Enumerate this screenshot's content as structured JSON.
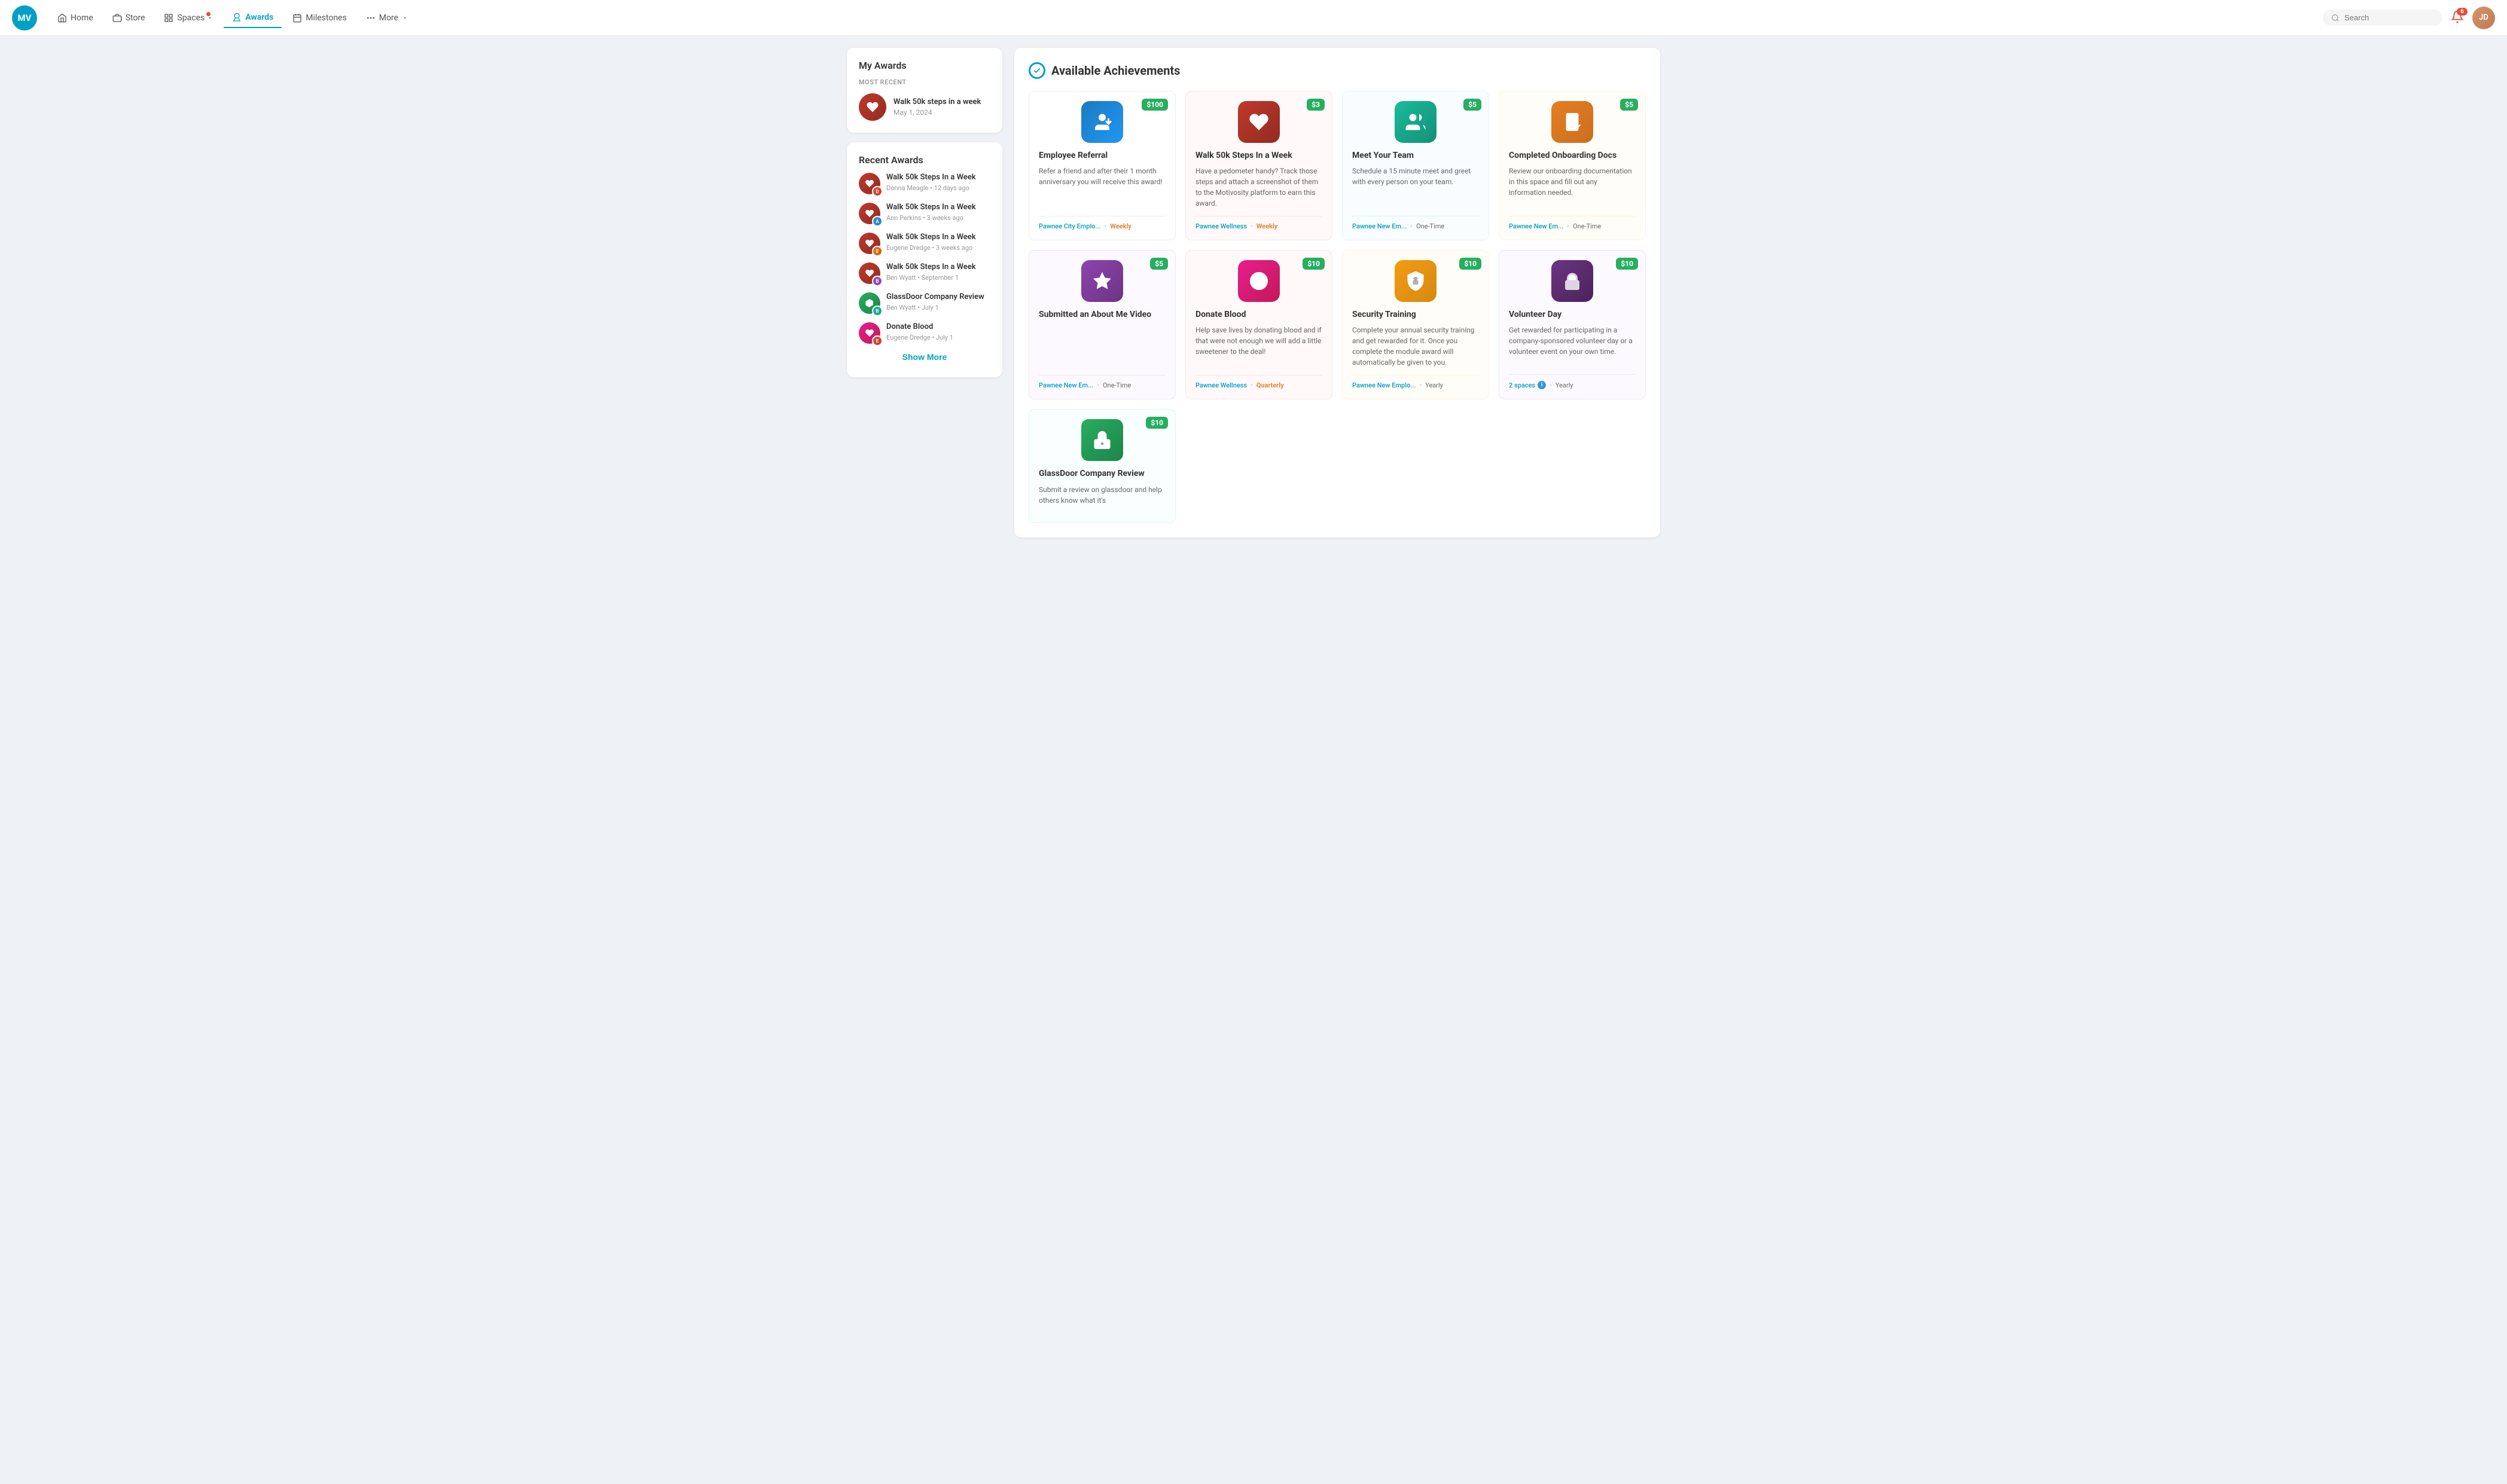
{
  "logo": {
    "initials": "MV"
  },
  "nav": {
    "links": [
      {
        "label": "Home",
        "icon": "home-icon",
        "active": false
      },
      {
        "label": "Store",
        "icon": "store-icon",
        "active": false
      },
      {
        "label": "Spaces",
        "icon": "spaces-icon",
        "active": false,
        "hasDropdown": true,
        "hasDot": true
      },
      {
        "label": "Awards",
        "icon": "awards-icon",
        "active": true
      },
      {
        "label": "Milestones",
        "icon": "milestones-icon",
        "active": false
      },
      {
        "label": "More",
        "icon": "more-icon",
        "active": false,
        "hasDropdown": true
      }
    ],
    "search_placeholder": "Search",
    "notifications_count": "6",
    "avatar_initials": "JD"
  },
  "sidebar": {
    "my_awards_title": "My Awards",
    "most_recent_label": "MOST RECENT",
    "most_recent": {
      "name": "Walk 50k steps in a week",
      "date": "May 1, 2024"
    },
    "recent_awards_title": "Recent Awards",
    "recent_list": [
      {
        "name": "Walk 50k Steps In a Week",
        "user": "Donna Meagle",
        "time": "12 days ago",
        "badge_type": "red",
        "user_color": "ua-donna"
      },
      {
        "name": "Walk 50k Steps In a Week",
        "user": "Ann Perkins",
        "time": "3 weeks ago",
        "badge_type": "red",
        "user_color": "ua-ann"
      },
      {
        "name": "Walk 50k Steps In a Week",
        "user": "Eugene Dredge",
        "time": "3 weeks ago",
        "badge_type": "red",
        "user_color": "ua-eugene"
      },
      {
        "name": "Walk 50k Steps In a Week",
        "user": "Ben Wyatt",
        "time": "September 1",
        "badge_type": "red",
        "user_color": "ua-ben"
      },
      {
        "name": "GlassDoor Company Review",
        "user": "Ben Wyatt",
        "time": "July 1",
        "badge_type": "green",
        "user_color": "ua-ben2"
      },
      {
        "name": "Donate Blood",
        "user": "Eugene Dredge",
        "time": "July 1",
        "badge_type": "pink",
        "user_color": "ua-eugene2"
      }
    ],
    "show_more_label": "Show More"
  },
  "achievements": {
    "title": "Available Achievements",
    "cards": [
      {
        "title": "Employee Referral",
        "price": "$100",
        "description": "Refer a friend and after their 1 month anniversary you will receive this award!",
        "company": "Pawnee City Emplo...",
        "frequency": "Weekly",
        "freq_class": "weekly",
        "icon_type": "blue-person",
        "icon_hex": "hex-blue"
      },
      {
        "title": "Walk 50k Steps In a Week",
        "price": "$3",
        "description": "Have a pedometer handy? Track those steps and attach a screenshot of them to the Motivosity platform to earn this award.",
        "company": "Pawnee Wellness",
        "frequency": "Weekly",
        "freq_class": "weekly",
        "icon_type": "red-heart",
        "icon_hex": "hex-red"
      },
      {
        "title": "Meet Your Team",
        "price": "$5",
        "description": "Schedule a 15 minute meet and greet with every person on your team.",
        "company": "Pawnee New Em...",
        "frequency": "One-Time",
        "freq_class": "onetime",
        "icon_type": "teal-team",
        "icon_hex": "hex-teal"
      },
      {
        "title": "Completed Onboarding Docs",
        "price": "$5",
        "description": "Review our onboarding documentation in this space and fill out any information needed.",
        "company": "Pawnee New Em...",
        "frequency": "One-Time",
        "freq_class": "onetime",
        "icon_type": "orange-doc",
        "icon_hex": "hex-orange"
      },
      {
        "title": "Submitted an About Me Video",
        "price": "$5",
        "description": "",
        "company": "Pawnee New Em...",
        "frequency": "One-Time",
        "freq_class": "onetime",
        "icon_type": "purple-star",
        "icon_hex": "hex-purple"
      },
      {
        "title": "Donate Blood",
        "price": "$10",
        "description": "Help save lives by donating blood and if that were not enough we will add a little sweetener to the deal!",
        "company": "Pawnee Wellness",
        "frequency": "Quarterly",
        "freq_class": "quarterly",
        "icon_type": "pink-blood",
        "icon_hex": "hex-pink"
      },
      {
        "title": "Security Training",
        "price": "$10",
        "description": "Complete your annual security training and get rewarded for it. Once you complete the module award will automatically be given to you.",
        "company": "Pawnee New Emplo...",
        "frequency": "Yearly",
        "freq_class": "yearly",
        "icon_type": "gold-lock",
        "icon_hex": "hex-gold"
      },
      {
        "title": "Volunteer Day",
        "price": "$10",
        "description": "Get rewarded for participating in a company-sponsored volunteer day or a volunteer event on your own time.",
        "company": "2 spaces",
        "frequency": "Yearly",
        "freq_class": "yearly",
        "icon_type": "violet-hand",
        "icon_hex": "hex-violet",
        "spaces_info": true
      },
      {
        "title": "GlassDoor Company Review",
        "price": "$10",
        "description": "Submit a review on glassdoor and help others know what it's",
        "company": "",
        "frequency": "",
        "freq_class": "",
        "icon_type": "green-glassdoor",
        "icon_hex": "hex-green"
      }
    ]
  }
}
